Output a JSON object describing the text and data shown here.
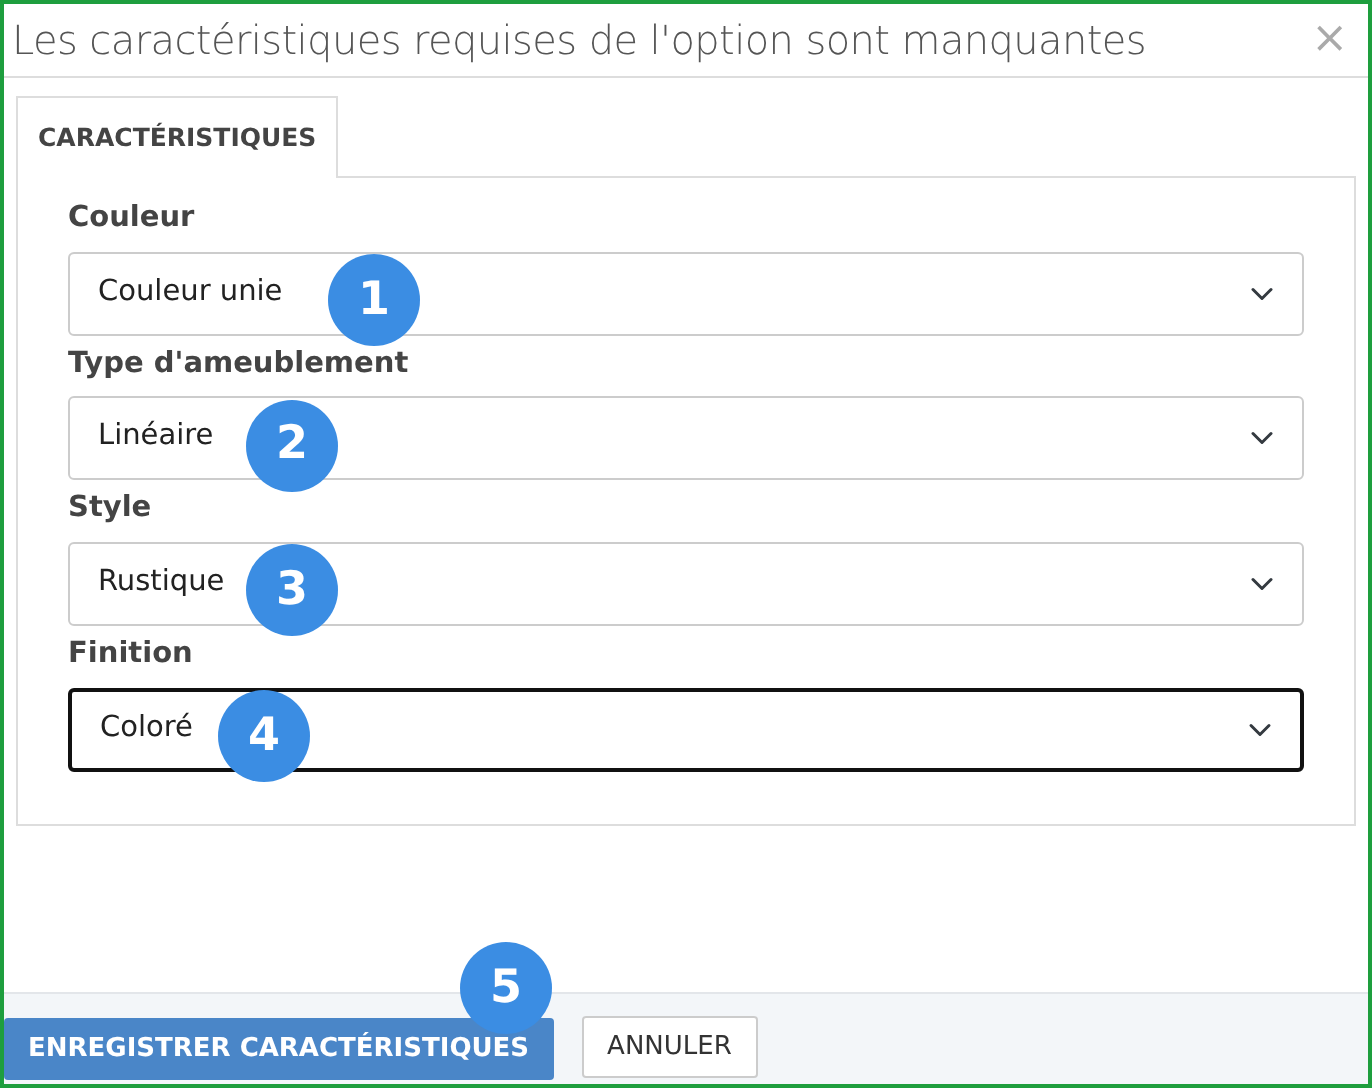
{
  "dialog": {
    "title": "Les caractéristiques requises de l'option sont manquantes",
    "close": "×"
  },
  "tabs": [
    {
      "label": "CARACTÉRISTIQUES",
      "selected": true
    }
  ],
  "fields": [
    {
      "label": "Couleur",
      "value": "Couleur unie",
      "focused": false,
      "callout": "1"
    },
    {
      "label": "Type d'ameublement",
      "value": "Linéaire",
      "focused": false,
      "callout": "2"
    },
    {
      "label": "Style",
      "value": "Rustique",
      "focused": false,
      "callout": "3"
    },
    {
      "label": "Finition",
      "value": "Coloré",
      "focused": true,
      "callout": "4"
    }
  ],
  "footer": {
    "callout": "5",
    "buttons": [
      {
        "label": "ENREGISTRER CARACTÉRISTIQUES",
        "kind": "primary"
      },
      {
        "label": "ANNULER",
        "kind": "secondary"
      }
    ]
  }
}
